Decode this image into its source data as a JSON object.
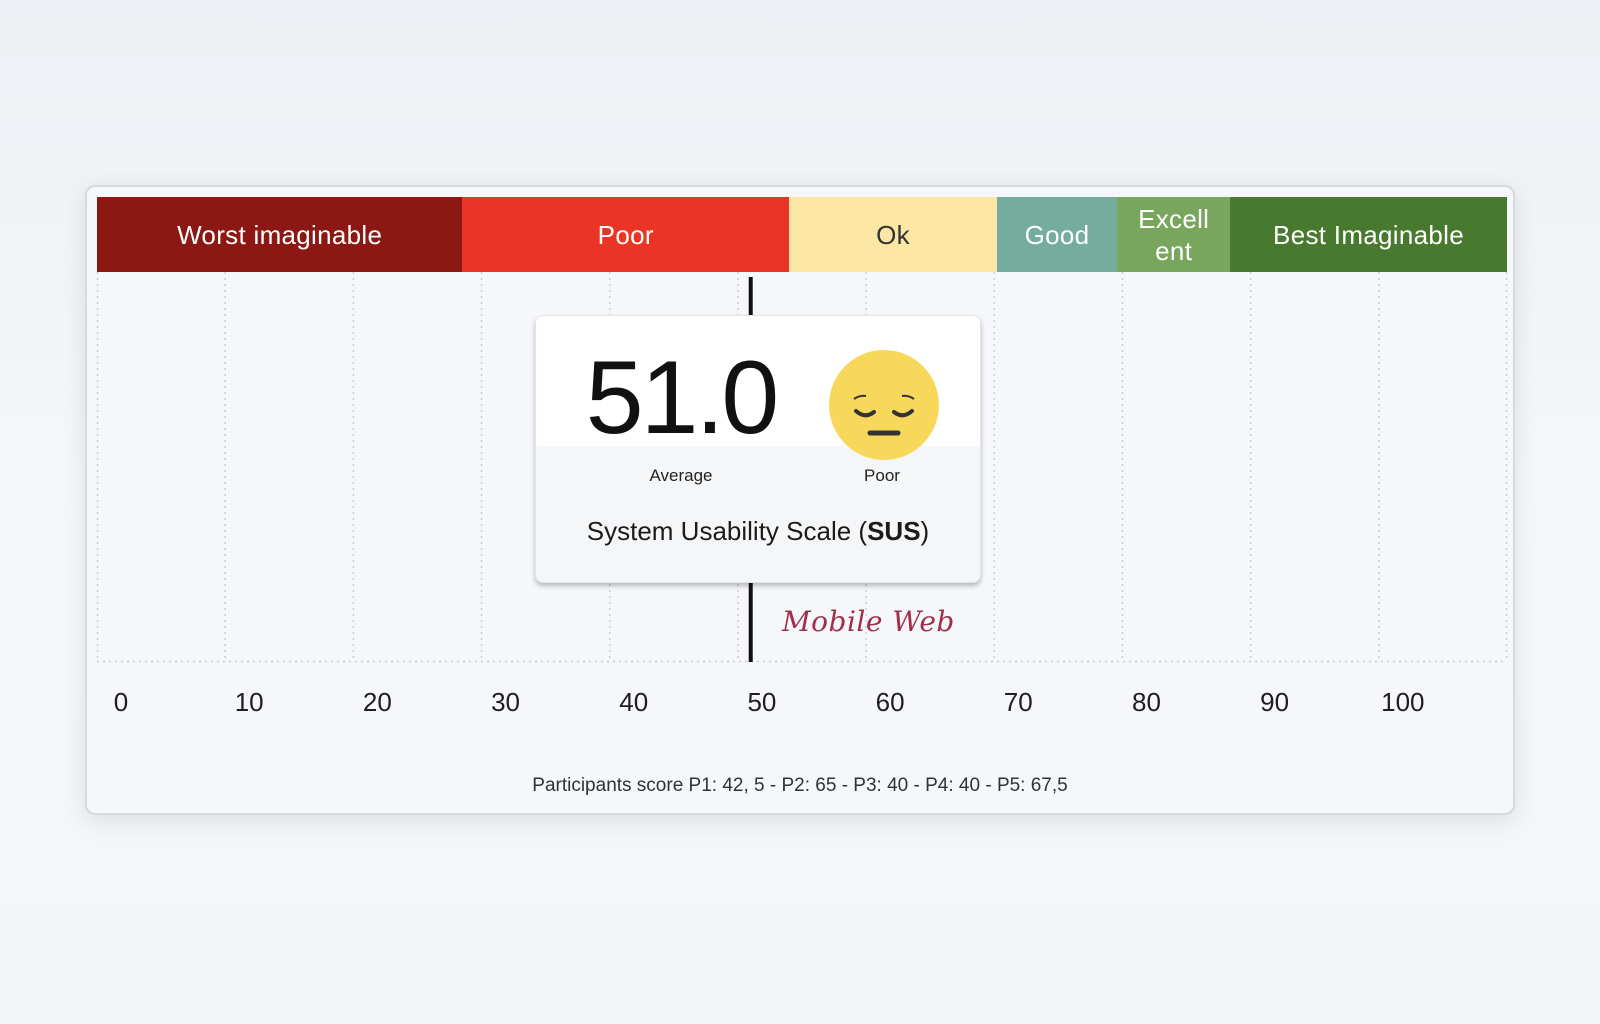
{
  "chart_data": {
    "type": "gauge",
    "scale_min": 0,
    "scale_max": 110,
    "ticks": [
      "0",
      "10",
      "20",
      "30",
      "40",
      "50",
      "60",
      "70",
      "80",
      "90",
      "100"
    ],
    "bands": [
      {
        "label": "Worst imaginable",
        "from": 0,
        "to": 28.5,
        "color": "#8b1812",
        "text_color": "#ffffff"
      },
      {
        "label": "Poor",
        "from": 28.5,
        "to": 54,
        "color": "#ea3425",
        "text_color": "#ffffff"
      },
      {
        "label": "Ok",
        "from": 54,
        "to": 70.2,
        "color": "#fbe6a4",
        "text_color": "#333333"
      },
      {
        "label": "Good",
        "from": 70.2,
        "to": 79.6,
        "color": "#74ad9e",
        "text_color": "#ffffff"
      },
      {
        "label": "Excell ent",
        "from": 79.6,
        "to": 88.4,
        "color": "#78a65c",
        "text_color": "#ffffff"
      },
      {
        "label": "Best Imaginable",
        "from": 88.4,
        "to": 110,
        "color": "#477a2e",
        "text_color": "#ffffff"
      }
    ],
    "marker": {
      "value": 51.0,
      "label": "Mobile Web"
    },
    "score": {
      "value": "51.0",
      "value_caption": "Average",
      "rating": "Poor",
      "title_prefix": "System Usability Scale (",
      "title_bold": "SUS",
      "title_suffix": ")"
    },
    "footnote": "Participants score P1: 42, 5 - P2: 65 - P3: 40 - P4: 40 - P5: 67,5"
  },
  "colors": {
    "marker_line": "#111111",
    "grid_line": "#c9ccd2",
    "face_fill": "#f7d85a",
    "face_features": "#333333"
  },
  "icons": {
    "rating_emoji": "pensive-face-icon"
  }
}
